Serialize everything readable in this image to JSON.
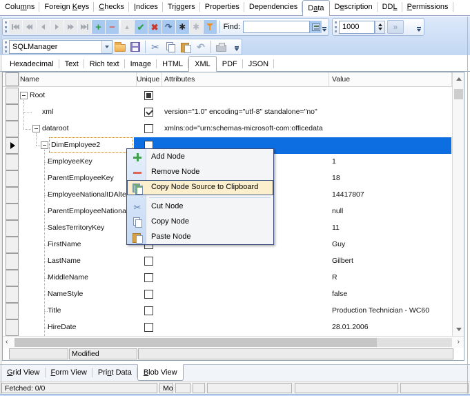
{
  "object_tabs": {
    "items": [
      {
        "label": "Columns",
        "u": 4,
        "selected": false
      },
      {
        "label": "Foreign Keys",
        "u": 8,
        "selected": false
      },
      {
        "label": "Checks",
        "u": 0,
        "selected": false
      },
      {
        "label": "Indices",
        "u": 0,
        "selected": false
      },
      {
        "label": "Triggers",
        "u": 2,
        "selected": false
      },
      {
        "label": "Properties",
        "u": -1,
        "selected": false
      },
      {
        "label": "Dependencies",
        "u": -1,
        "selected": false
      },
      {
        "label": "Data",
        "u": 1,
        "selected": true
      },
      {
        "label": "Description",
        "u": 1,
        "selected": false
      },
      {
        "label": "DDL",
        "u": 2,
        "selected": false
      },
      {
        "label": "Permissions",
        "u": 0,
        "selected": false
      }
    ]
  },
  "navigator": {
    "find_label": "Find:",
    "find_value": "",
    "limit_value": "1000"
  },
  "blob_toolbar": {
    "combo_value": "SQLManager"
  },
  "format_tabs": {
    "items": [
      "Hexadecimal",
      "Text",
      "Rich text",
      "Image",
      "HTML",
      "XML",
      "PDF",
      "JSON"
    ],
    "selected_index": 5
  },
  "grid": {
    "columns": [
      "Name",
      "Unique",
      "Attributes",
      "Value"
    ],
    "rows": [
      {
        "name": "Root",
        "level": 0,
        "expanded": true,
        "check": "indeterminate",
        "attributes": "",
        "value": "",
        "selected": false
      },
      {
        "name": "xml",
        "level": 1,
        "expanded": null,
        "check": "checked",
        "attributes": "version=\"1.0\" encoding=\"utf-8\" standalone=\"no\"",
        "value": "",
        "selected": false
      },
      {
        "name": "dataroot",
        "level": 1,
        "expanded": true,
        "check": "unchecked",
        "attributes": "xmlns:od=\"urn:schemas-microsoft-com:officedata",
        "value": "",
        "selected": false
      },
      {
        "name": "DimEmployee2",
        "level": 2,
        "expanded": true,
        "check": "unchecked",
        "attributes": "",
        "value": "",
        "selected": true
      },
      {
        "name": "EmployeeKey",
        "level": 3,
        "expanded": null,
        "check": "unchecked",
        "attributes": "",
        "value": "1",
        "selected": false
      },
      {
        "name": "ParentEmployeeKey",
        "level": 3,
        "expanded": null,
        "check": "unchecked",
        "attributes": "",
        "value": "18",
        "selected": false
      },
      {
        "name": "EmployeeNationalIDAltern",
        "level": 3,
        "expanded": null,
        "check": "unchecked",
        "attributes": "",
        "value": "14417807",
        "selected": false
      },
      {
        "name": "ParentEmployeeNationa",
        "level": 3,
        "expanded": null,
        "check": "unchecked",
        "attributes": "",
        "value": "null",
        "selected": false
      },
      {
        "name": "SalesTerritoryKey",
        "level": 3,
        "expanded": null,
        "check": "unchecked",
        "attributes": "",
        "value": "11",
        "selected": false
      },
      {
        "name": "FirstName",
        "level": 3,
        "expanded": null,
        "check": "unchecked",
        "attributes": "",
        "value": "Guy",
        "selected": false
      },
      {
        "name": "LastName",
        "level": 3,
        "expanded": null,
        "check": "unchecked",
        "attributes": "",
        "value": "Gilbert",
        "selected": false
      },
      {
        "name": "MiddleName",
        "level": 3,
        "expanded": null,
        "check": "unchecked",
        "attributes": "",
        "value": "R",
        "selected": false
      },
      {
        "name": "NameStyle",
        "level": 3,
        "expanded": null,
        "check": "unchecked",
        "attributes": "",
        "value": "false",
        "selected": false
      },
      {
        "name": "Title",
        "level": 3,
        "expanded": null,
        "check": "unchecked",
        "attributes": "",
        "value": "Production Technician - WC60",
        "selected": false
      },
      {
        "name": "HireDate",
        "level": 3,
        "expanded": null,
        "check": "unchecked",
        "attributes": "",
        "value": "28.01.2006",
        "selected": false
      }
    ]
  },
  "context_menu": {
    "items": [
      {
        "label": "Add Node",
        "icon": "add-node-icon",
        "highlighted": false
      },
      {
        "label": "Remove Node",
        "icon": "remove-node-icon",
        "highlighted": false
      },
      {
        "label": "Copy Node Source to Clipboard",
        "icon": "copy-node-source-icon",
        "highlighted": true
      },
      {
        "separator": true
      },
      {
        "label": "Cut Node",
        "icon": "cut-node-icon",
        "highlighted": false
      },
      {
        "label": "Copy Node",
        "icon": "copy-node-icon",
        "highlighted": false
      },
      {
        "label": "Paste Node",
        "icon": "paste-node-icon",
        "highlighted": false
      }
    ]
  },
  "blob_status": {
    "modified": "Modified"
  },
  "view_tabs": {
    "items": [
      {
        "label": "Grid View",
        "u": 0,
        "selected": false
      },
      {
        "label": "Form View",
        "u": 0,
        "selected": false
      },
      {
        "label": "Print Data",
        "u": 3,
        "selected": false
      },
      {
        "label": "Blob View",
        "u": 0,
        "selected": true
      }
    ]
  },
  "status_bar": {
    "fetched": "Fetched: 0/0",
    "modified": "Modified"
  }
}
